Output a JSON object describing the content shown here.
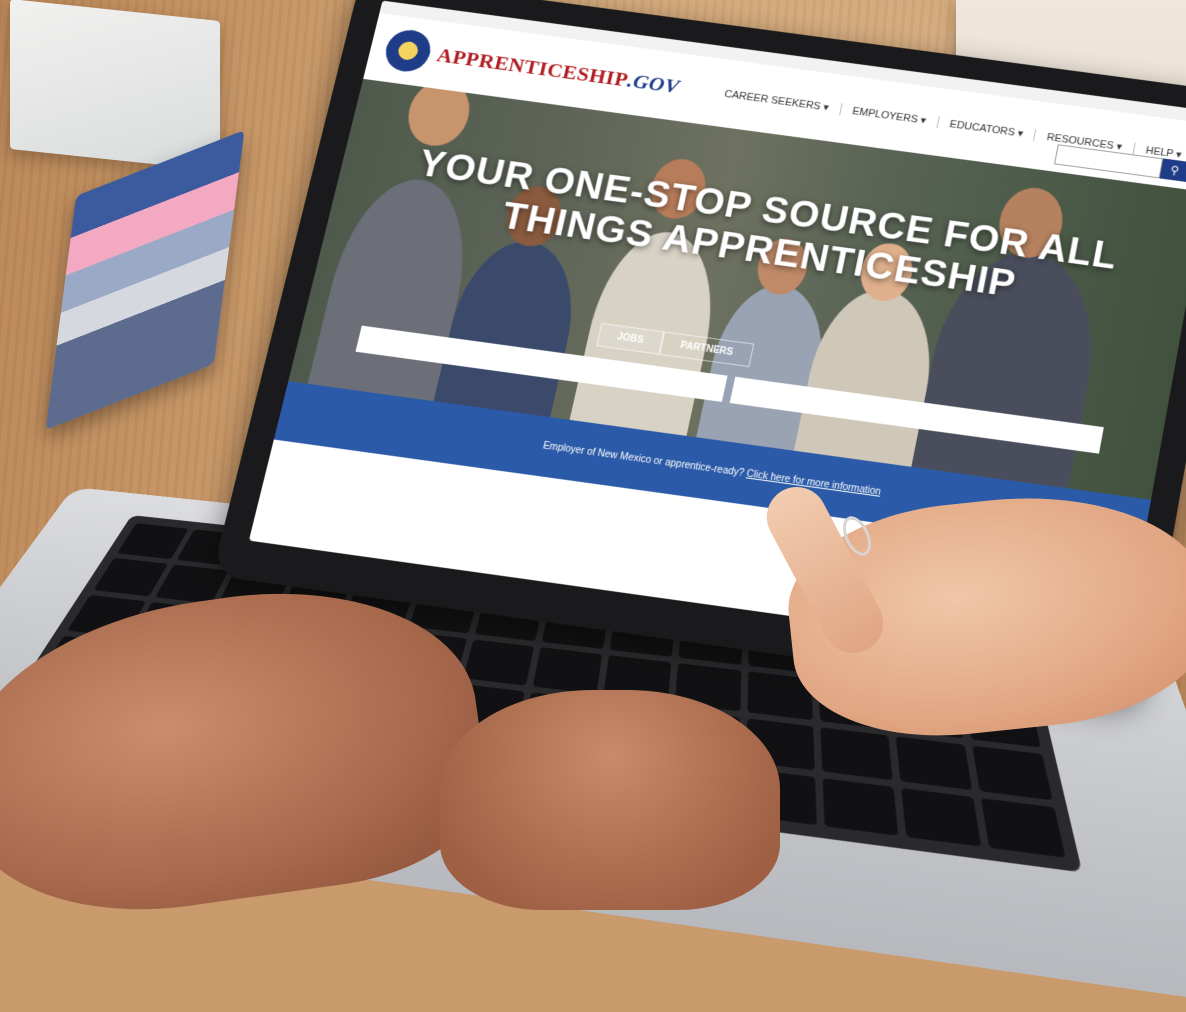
{
  "website": {
    "logo": {
      "main": "APPRENTICESHIP",
      "suffix": ".GOV"
    },
    "nav": [
      "CAREER SEEKERS ▾",
      "EMPLOYERS ▾",
      "EDUCATORS ▾",
      "RESOURCES ▾",
      "HELP ▾"
    ],
    "search_button_icon": "search-icon",
    "hero_title": "YOUR ONE-STOP SOURCE FOR ALL THINGS APPRENTICESHIP",
    "tabs": [
      "JOBS",
      "PARTNERS"
    ],
    "banner_text": "Employer of New Mexico or apprentice-ready?",
    "banner_link": "Click here for more information"
  },
  "colors": {
    "brand_red": "#b01e23",
    "brand_blue": "#1f3c88",
    "banner_blue": "#2b5aa8"
  }
}
